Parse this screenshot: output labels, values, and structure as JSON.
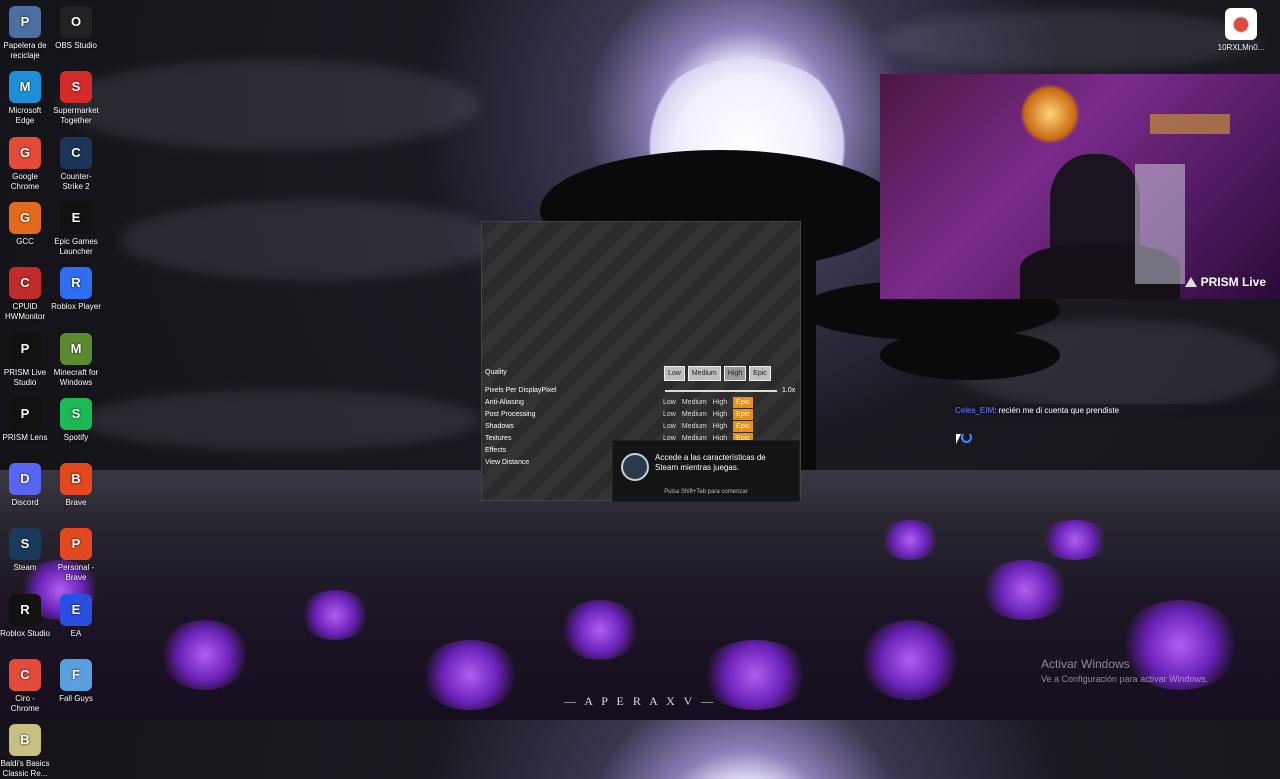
{
  "desktop_icons_left": [
    {
      "label": "Papelera de reciclaje",
      "icon": "recycle-bin-icon",
      "bg": "#4a6fa0"
    },
    {
      "label": "OBS Studio",
      "icon": "obs-icon",
      "bg": "#222222"
    },
    {
      "label": "Microsoft Edge",
      "icon": "edge-icon",
      "bg": "#1d8fd8"
    },
    {
      "label": "Supermarket Together",
      "icon": "supermarket-icon",
      "bg": "#d52a2a"
    },
    {
      "label": "Google Chrome",
      "icon": "chrome-icon",
      "bg": "#e24a3a"
    },
    {
      "label": "Counter-Strike 2",
      "icon": "cs2-icon",
      "bg": "#1c3458"
    },
    {
      "label": "GCC",
      "icon": "gcc-icon",
      "bg": "#e26a1a"
    },
    {
      "label": "Epic Games Launcher",
      "icon": "epic-games-icon",
      "bg": "#111111"
    },
    {
      "label": "CPUID HWMonitor",
      "icon": "hwmonitor-icon",
      "bg": "#c22b2b"
    },
    {
      "label": "Roblox Player",
      "icon": "roblox-icon",
      "bg": "#2f6df0"
    },
    {
      "label": "PRISM Live Studio",
      "icon": "prism-icon",
      "bg": "#111111"
    },
    {
      "label": "Minecraft for Windows",
      "icon": "minecraft-icon",
      "bg": "#5b8b2e"
    },
    {
      "label": "PRISM Lens",
      "icon": "prism-lens-icon",
      "bg": "#111111"
    },
    {
      "label": "Spotify",
      "icon": "spotify-icon",
      "bg": "#1db954"
    },
    {
      "label": "Discord",
      "icon": "discord-icon",
      "bg": "#5865f2"
    },
    {
      "label": "Brave",
      "icon": "brave-icon",
      "bg": "#e2471e"
    },
    {
      "label": "Steam",
      "icon": "steam-icon",
      "bg": "#1a3a5c"
    },
    {
      "label": "Personal - Brave",
      "icon": "brave-personal-icon",
      "bg": "#e2471e"
    },
    {
      "label": "Roblox Studio",
      "icon": "roblox-studio-icon",
      "bg": "#111111"
    },
    {
      "label": "EA",
      "icon": "ea-icon",
      "bg": "#2a4ee0"
    },
    {
      "label": "Ciro - Chrome",
      "icon": "chrome-profile-icon",
      "bg": "#e24a3a"
    },
    {
      "label": "Fall Guys",
      "icon": "fall-guys-icon",
      "bg": "#5aa0e0"
    },
    {
      "label": "Baldi's Basics Classic Re...",
      "icon": "baldi-icon",
      "bg": "#c8c080"
    }
  ],
  "desktop_icon_right": {
    "label": "10RXLMn0...",
    "icon": "chrome-file-icon",
    "bg": "#ffffff"
  },
  "settings": {
    "quality_label": "Quality",
    "quality_buttons": [
      "Low",
      "Medium",
      "High",
      "Epic"
    ],
    "pixels_label": "Pixels Per DisplayPixel",
    "pixels_value": "1.0x",
    "pixels_fraction": 1.0,
    "rows": [
      {
        "label": "Anti-Aliasing",
        "options": [
          "Low",
          "Medium",
          "High",
          "Epic"
        ],
        "selected": "Epic"
      },
      {
        "label": "Post Processing",
        "options": [
          "Low",
          "Medium",
          "High",
          "Epic"
        ],
        "selected": "Epic"
      },
      {
        "label": "Shadows",
        "options": [
          "Low",
          "Medium",
          "High",
          "Epic"
        ],
        "selected": "Epic"
      },
      {
        "label": "Textures",
        "options": [
          "Low",
          "Medium",
          "High",
          "Epic"
        ],
        "selected": "Epic"
      },
      {
        "label": "Effects"
      },
      {
        "label": "View Distance"
      }
    ]
  },
  "steam_overlay": {
    "message": "Accede a las características de Steam mientras juegas.",
    "hint": "Pulsa Shift+Tab para comenzar"
  },
  "webcam": {
    "brand": "PRISM Live"
  },
  "chat": {
    "user": "Celes_EIM",
    "message": ": recién me di cuenta que prendiste"
  },
  "activation": {
    "title": "Activar Windows",
    "subtitle": "Ve a Configuración para activar Windows."
  },
  "wallpaper_text": "— A P E R A  X V —",
  "colors": {
    "accent_epic": "#e8901a",
    "chat_user": "#6f7bff",
    "steam_bg": "#121416"
  }
}
